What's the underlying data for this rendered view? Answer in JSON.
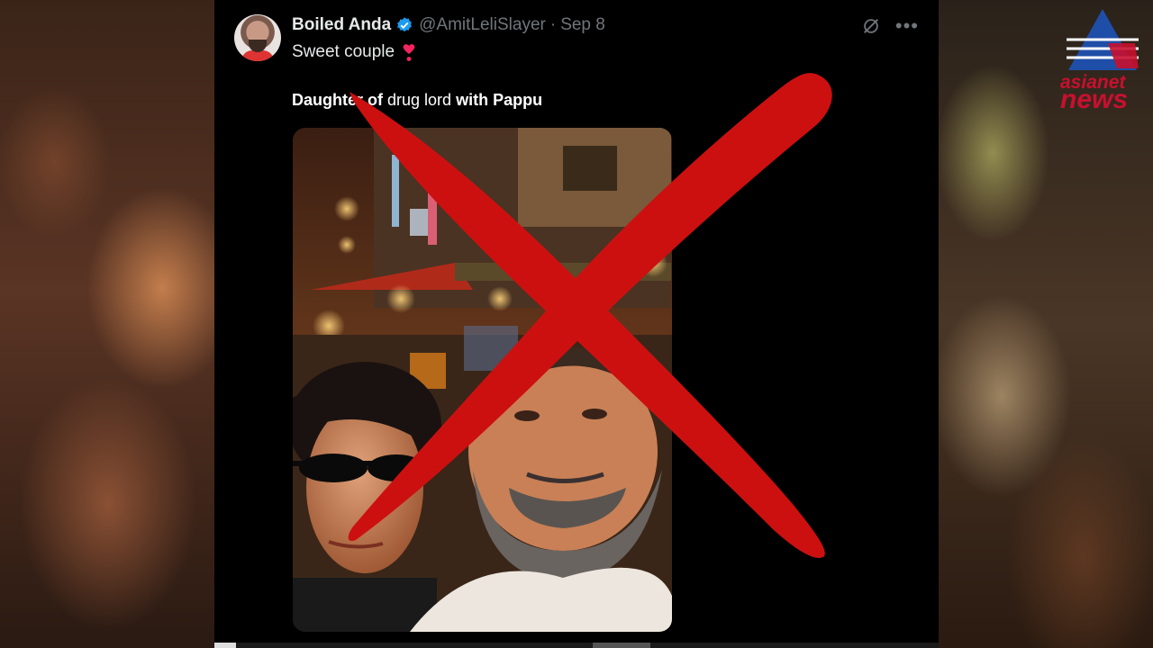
{
  "tweet": {
    "author_name": "Boiled Anda",
    "handle": "@AmitLeliSlayer",
    "separator": "·",
    "date": "Sep 8",
    "text": "Sweet couple",
    "caption_bold1": "Daughter of",
    "caption_normal": "drug lord",
    "caption_bold2": "with Pappu"
  },
  "icons": {
    "verified": "verified-badge-icon",
    "grok": "grok-icon",
    "more": "more-icon",
    "heart": "heart-exclamation-icon"
  },
  "more_glyph": "•••",
  "logo": {
    "line1": "asianet",
    "line2": "news"
  },
  "colors": {
    "background": "#000000",
    "overlay_x": "#cc1010",
    "verified": "#1d9bf0",
    "logo_red": "#c8102e",
    "logo_blue": "#1f4ea8"
  }
}
